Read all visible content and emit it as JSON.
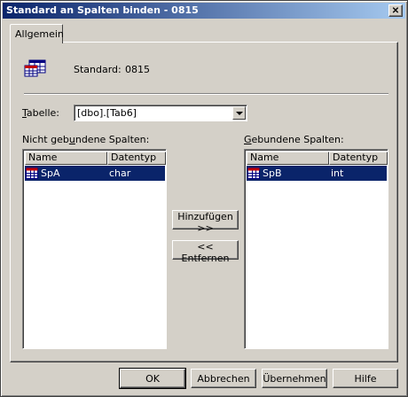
{
  "window": {
    "title": "Standard an Spalten binden - 0815",
    "close_label": "✕"
  },
  "tabs": [
    {
      "label": "Allgemein"
    }
  ],
  "standard": {
    "label": "Standard:",
    "value": "0815",
    "icon": "default-object-icon"
  },
  "table_select": {
    "label": "Tabelle:",
    "value": "[dbo].[Tab6]"
  },
  "unbound": {
    "caption": "Nicht gebundene Spalten:",
    "columns": [
      "Name",
      "Datentyp"
    ],
    "rows": [
      {
        "name": "SpA",
        "type": "char",
        "icon": "column-icon",
        "selected": true
      }
    ]
  },
  "bound": {
    "caption": "Gebundene Spalten:",
    "columns": [
      "Name",
      "Datentyp"
    ],
    "rows": [
      {
        "name": "SpB",
        "type": "int",
        "icon": "column-icon",
        "selected": true
      }
    ]
  },
  "actions": {
    "add": "Hinzufügen >>",
    "remove": "<< Entfernen"
  },
  "footer": {
    "ok": "OK",
    "cancel": "Abbrechen",
    "apply": "Übernehmen",
    "help": "Hilfe"
  },
  "colors": {
    "title_start": "#0a246a",
    "title_end": "#a6caf0",
    "selection": "#0a246a",
    "face": "#d4d0c8"
  }
}
